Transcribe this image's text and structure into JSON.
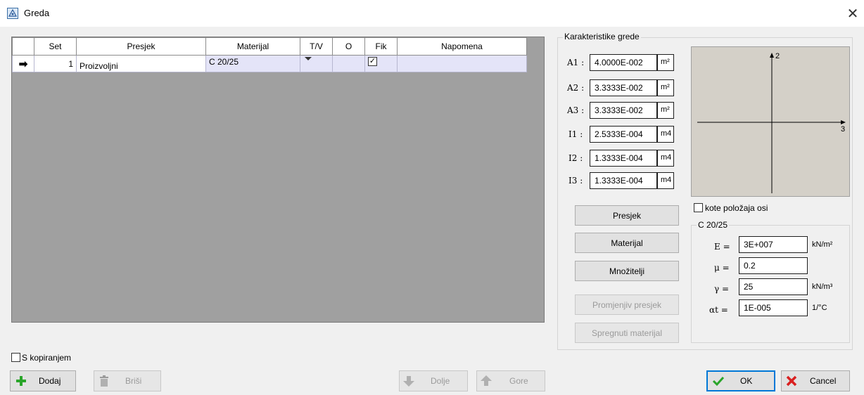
{
  "window": {
    "title": "Greda",
    "close_glyph": "✕"
  },
  "grid": {
    "columns": [
      "Set",
      "Presjek",
      "Materijal",
      "T/V",
      "O",
      "Fik",
      "Napomena"
    ],
    "rows": [
      {
        "indicator": "➡",
        "set": "1",
        "presjek": "Proizvoljni",
        "materijal": "C 20/25",
        "tv": "",
        "o": "",
        "fik_checked": true,
        "napomena": ""
      }
    ]
  },
  "properties": {
    "title": "Karakteristike grede",
    "items": [
      {
        "label": "A1 :",
        "value": "4.0000E-002",
        "unit": "m²"
      },
      {
        "label": "A2 :",
        "value": "3.3333E-002",
        "unit": "m²"
      },
      {
        "label": "A3 :",
        "value": "3.3333E-002",
        "unit": "m²"
      },
      {
        "label": "I1 :",
        "value": "2.5333E-004",
        "unit": "m4"
      },
      {
        "label": "I2 :",
        "value": "1.3333E-004",
        "unit": "m4"
      },
      {
        "label": "I3 :",
        "value": "1.3333E-004",
        "unit": "m4"
      }
    ]
  },
  "axes": {
    "vertical": "2",
    "horizontal": "3"
  },
  "buttons": {
    "presjek": "Presjek",
    "materijal": "Materijal",
    "mnozitelji": "Množitelji",
    "promjenjiv": "Promjenjiv presjek",
    "spregnuti": "Spregnuti materijal",
    "dodaj": "Dodaj",
    "brisi": "Briši",
    "dolje": "Dolje",
    "gore": "Gore",
    "ok": "OK",
    "cancel": "Cancel"
  },
  "kote_checkbox": {
    "label": "kote položaja osi",
    "checked": false
  },
  "kopiranje_checkbox": {
    "label": "S kopiranjem",
    "checked": false
  },
  "material": {
    "title": "C 20/25",
    "items": [
      {
        "label": "E =",
        "value": "3E+007",
        "unit": "kN/m²"
      },
      {
        "label": "μ =",
        "value": "0.2",
        "unit": ""
      },
      {
        "label": "γ =",
        "value": "25",
        "unit": "kN/m³"
      },
      {
        "label": "αt =",
        "value": "1E-005",
        "unit": "1/°C"
      }
    ]
  },
  "colors": {
    "grid_bg": "#a0a0a0",
    "row_selected": "#e4e4f8",
    "diagram_bg": "#d4d0c8",
    "ok_border": "#0078d7"
  }
}
